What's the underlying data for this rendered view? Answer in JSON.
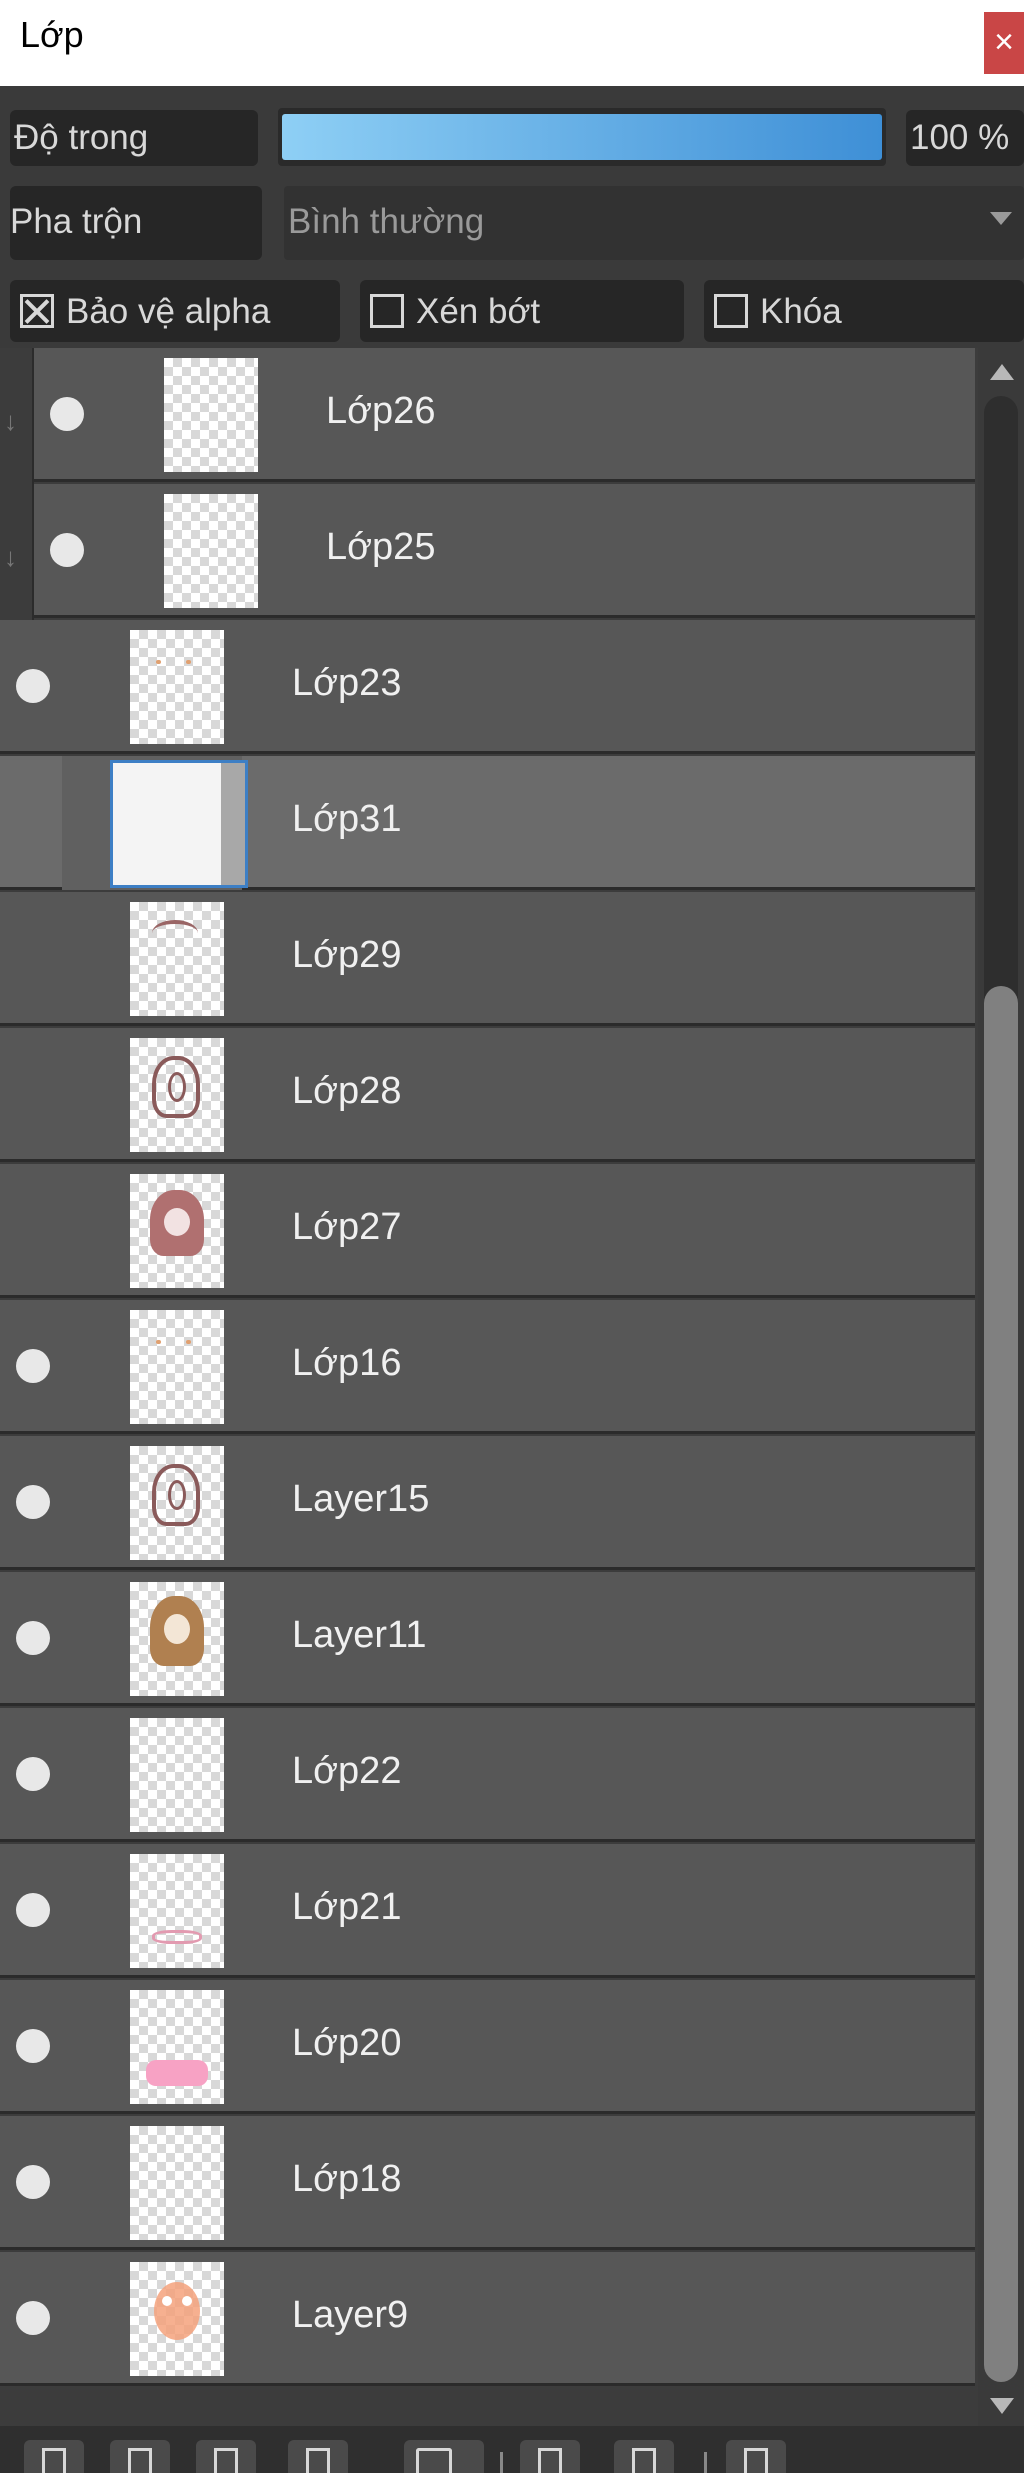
{
  "window": {
    "title": "Lớp",
    "close_glyph": "×"
  },
  "opacity": {
    "label": "Độ trong",
    "value_text": "100 %",
    "value_percent": 100
  },
  "blend": {
    "label": "Pha trộn",
    "value": "Bình thường"
  },
  "options": {
    "protect_alpha": {
      "label": "Bảo vệ alpha",
      "checked": true
    },
    "clip": {
      "label": "Xén bớt",
      "checked": false
    },
    "lock": {
      "label": "Khóa",
      "checked": false
    }
  },
  "layers": [
    {
      "name": "Lớp26",
      "visible": true,
      "clipped": true,
      "thumb": "blank"
    },
    {
      "name": "Lớp25",
      "visible": true,
      "clipped": true,
      "thumb": "blank"
    },
    {
      "name": "Lớp23",
      "visible": true,
      "clipped": false,
      "thumb": "dots-orange"
    },
    {
      "name": "Lớp31",
      "visible": false,
      "clipped": false,
      "selected": true,
      "thumb": "white"
    },
    {
      "name": "Lớp29",
      "visible": false,
      "clipped": false,
      "thumb": "hair-strand"
    },
    {
      "name": "Lớp28",
      "visible": false,
      "clipped": false,
      "thumb": "hair-outline"
    },
    {
      "name": "Lớp27",
      "visible": false,
      "clipped": false,
      "thumb": "hair-brown"
    },
    {
      "name": "Lớp16",
      "visible": true,
      "clipped": false,
      "thumb": "dots-orange"
    },
    {
      "name": "Layer15",
      "visible": true,
      "clipped": false,
      "thumb": "hair-outline"
    },
    {
      "name": "Layer11",
      "visible": true,
      "clipped": false,
      "thumb": "hair-tan"
    },
    {
      "name": "Lớp22",
      "visible": true,
      "clipped": false,
      "thumb": "blank"
    },
    {
      "name": "Lớp21",
      "visible": true,
      "clipped": false,
      "thumb": "pink-outline"
    },
    {
      "name": "Lớp20",
      "visible": true,
      "clipped": false,
      "thumb": "pink-fill"
    },
    {
      "name": "Lớp18",
      "visible": true,
      "clipped": false,
      "thumb": "blank"
    },
    {
      "name": "Layer9",
      "visible": true,
      "clipped": false,
      "thumb": "face-orange"
    }
  ],
  "toolbar": [
    "new-layer-icon",
    "new-layer-icon",
    "new-layer-icon",
    "new-layer-icon",
    "folder-icon",
    "duplicate-icon",
    "merge-icon",
    "trash-icon"
  ],
  "colors": {
    "accent": "#3e8fd6",
    "close": "#c94646",
    "row": "#575757",
    "selected_row": "#6b6b6b"
  }
}
